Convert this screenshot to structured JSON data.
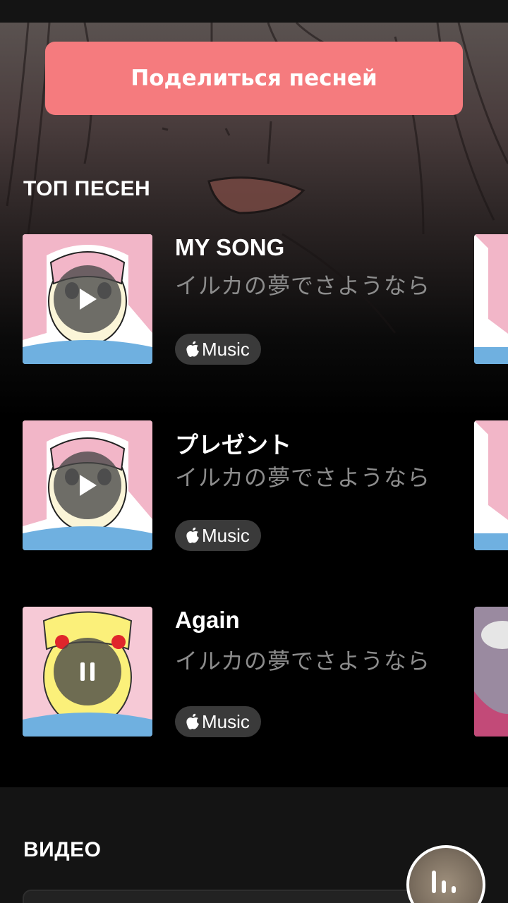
{
  "share": {
    "label": "Поделиться песней"
  },
  "top_songs": {
    "title": "ТОП ПЕСЕН",
    "items": [
      {
        "title": "MY SONG",
        "artist": "イルカの夢でさようなら",
        "badge": "Music",
        "state": "play"
      },
      {
        "title": "プレゼント",
        "artist": "イルカの夢でさようなら",
        "badge": "Music",
        "state": "play"
      },
      {
        "title": "Again",
        "artist": "イルカの夢でさようなら",
        "badge": "Music",
        "state": "pause"
      }
    ]
  },
  "video": {
    "title": "ВИДЕО"
  },
  "colors": {
    "accent": "#f57b7e",
    "background": "#000000",
    "badge": "#3a3a3a",
    "muted_text": "#8c8c8c"
  }
}
